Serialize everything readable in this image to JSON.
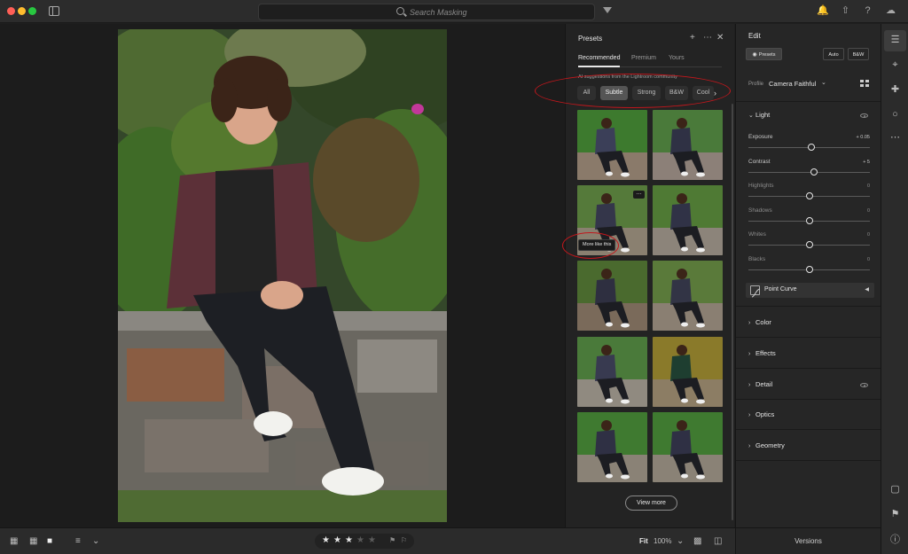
{
  "search": {
    "placeholder": "Search Masking"
  },
  "presets_panel": {
    "title": "Presets",
    "tabs": [
      "Recommended",
      "Premium",
      "Yours"
    ],
    "active_tab": "Recommended",
    "ai_note": "AI suggestions from the Lightroom community",
    "chips": [
      "All",
      "Subtle",
      "Strong",
      "B&W",
      "Cool"
    ],
    "active_chip": "Subtle",
    "tooltip": "More like this",
    "view_more": "View more"
  },
  "edit_panel": {
    "title": "Edit",
    "presets_button": "Presets",
    "auto_button": "Auto",
    "bw_button": "B&W",
    "profile_label": "Profile",
    "profile_value": "Camera Faithful",
    "light": {
      "label": "Light",
      "sliders": [
        {
          "label": "Exposure",
          "value": "+ 0.05",
          "level": 0.52
        },
        {
          "label": "Contrast",
          "value": "+ 5",
          "level": 0.54
        },
        {
          "label": "Highlights",
          "value": "0",
          "level": 0.5
        },
        {
          "label": "Shadows",
          "value": "0",
          "level": 0.5
        },
        {
          "label": "Whites",
          "value": "0",
          "level": 0.5
        },
        {
          "label": "Blacks",
          "value": "0",
          "level": 0.5
        }
      ]
    },
    "point_curve": "Point Curve",
    "sections": [
      "Color",
      "Effects",
      "Detail",
      "Optics",
      "Geometry"
    ]
  },
  "bottom_bar": {
    "rating": 3,
    "rating_max": 5,
    "fit_label": "Fit",
    "zoom": "100%",
    "versions": "Versions"
  },
  "colors": {
    "annotation_red": "#c2171c",
    "panel_bg": "#232323",
    "star_on": "#e6e6e6",
    "star_off": "#5a5a5a"
  }
}
